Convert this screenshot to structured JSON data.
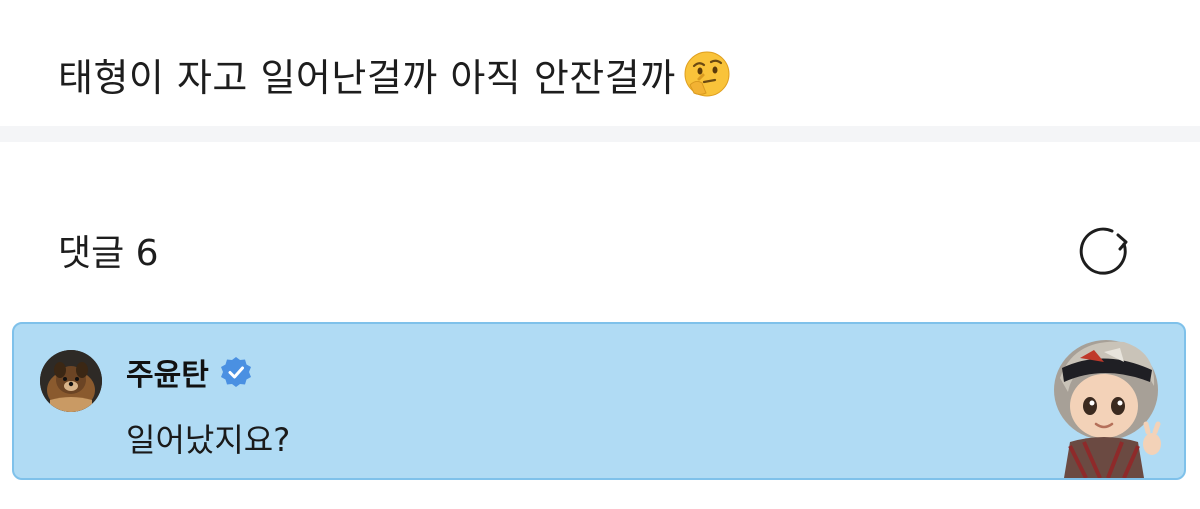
{
  "post": {
    "text": "태형이 자고 일어난걸까 아직 안잔걸까",
    "emoji": "thinking-face-emoji"
  },
  "comments": {
    "header": "댓글 6",
    "refresh_icon": "refresh-icon"
  },
  "comment": {
    "username": "주윤탄",
    "verified": true,
    "text": "일어났지요?",
    "highlight_color": "#b0dbf4",
    "border_color": "#7fc1ea"
  },
  "colors": {
    "verified_badge": "#4a90e2",
    "divider": "#f4f5f7"
  }
}
